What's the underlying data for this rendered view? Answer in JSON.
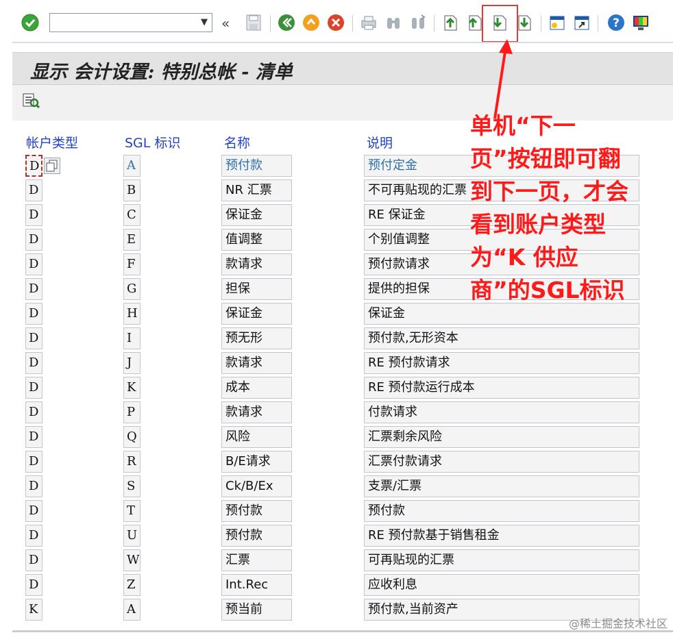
{
  "toolbar": {
    "command_field_value": "",
    "icons": [
      "enter-icon",
      "back-nav-icon",
      "save-icon",
      "back-icon",
      "exit-icon",
      "cancel-icon",
      "print-icon",
      "find-icon",
      "find-next-icon",
      "first-page-icon",
      "previous-page-icon",
      "next-page-icon",
      "last-page-icon",
      "new-session-icon",
      "shortcut-icon",
      "help-icon",
      "layout-icon"
    ]
  },
  "title": "显示 会计设置: 特别总帐 - 清单",
  "table": {
    "headers": {
      "account_type": "帐户类型",
      "sgl": "SGL 标识",
      "name": "名称",
      "description": "说明"
    },
    "rows": [
      {
        "acct": "D",
        "sgl": "A",
        "name": "预付款",
        "desc": "预付定金"
      },
      {
        "acct": "D",
        "sgl": "B",
        "name": "NR 汇票",
        "desc": "不可再贴现的汇票"
      },
      {
        "acct": "D",
        "sgl": "C",
        "name": "保证金",
        "desc": "RE 保证金"
      },
      {
        "acct": "D",
        "sgl": "E",
        "name": "值调整",
        "desc": "个别值调整"
      },
      {
        "acct": "D",
        "sgl": "F",
        "name": "款请求",
        "desc": "预付款请求"
      },
      {
        "acct": "D",
        "sgl": "G",
        "name": "担保",
        "desc": "提供的担保"
      },
      {
        "acct": "D",
        "sgl": "H",
        "name": "保证金",
        "desc": "保证金"
      },
      {
        "acct": "D",
        "sgl": "I",
        "name": "预无形",
        "desc": "预付款,无形资本"
      },
      {
        "acct": "D",
        "sgl": "J",
        "name": "款请求",
        "desc": "RE 预付款请求"
      },
      {
        "acct": "D",
        "sgl": "K",
        "name": "成本",
        "desc": "RE 预付款运行成本"
      },
      {
        "acct": "D",
        "sgl": "P",
        "name": "款请求",
        "desc": "付款请求"
      },
      {
        "acct": "D",
        "sgl": "Q",
        "name": "风险",
        "desc": "汇票剩余风险"
      },
      {
        "acct": "D",
        "sgl": "R",
        "name": "B/E请求",
        "desc": "汇票付款请求"
      },
      {
        "acct": "D",
        "sgl": "S",
        "name": "Ck/B/Ex",
        "desc": "支票/汇票"
      },
      {
        "acct": "D",
        "sgl": "T",
        "name": "预付款",
        "desc": "预付款"
      },
      {
        "acct": "D",
        "sgl": "U",
        "name": "预付款",
        "desc": "RE 预付款基于销售租金"
      },
      {
        "acct": "D",
        "sgl": "W",
        "name": "汇票",
        "desc": "可再贴现的汇票"
      },
      {
        "acct": "D",
        "sgl": "Z",
        "name": "Int.Rec",
        "desc": "应收利息"
      },
      {
        "acct": "K",
        "sgl": "A",
        "name": "预当前",
        "desc": "预付款,当前资产"
      }
    ]
  },
  "annotation": {
    "lines": [
      "单机“下一",
      "页”按钮即可翻",
      "到下一页，才会",
      "看到账户类型",
      "为“K 供应",
      "商”的SGL标识"
    ],
    "color": "#ff1a1a"
  },
  "watermark": "@稀土掘金技术社区",
  "colors": {
    "header_text": "#1f42c8",
    "annotation": "#ff1a1a",
    "enter_green": "#3aa63a"
  }
}
